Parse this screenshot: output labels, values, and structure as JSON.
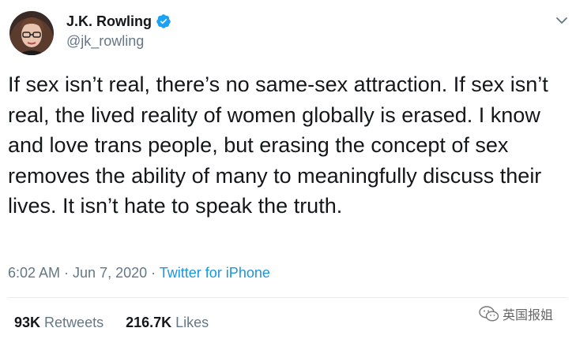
{
  "author": {
    "display_name": "J.K. Rowling",
    "handle": "@jk_rowling",
    "verified_icon": "verified-badge-icon",
    "avatar_icon": "avatar"
  },
  "tweet": {
    "text": "If sex isn’t real, there’s no same-sex attraction. If sex isn’t real, the lived reality of women globally is erased. I know and love trans people, but erasing the concept of sex removes the ability of many to meaningfully discuss their lives. It isn’t hate to speak the truth."
  },
  "meta": {
    "time": "6:02 AM",
    "separator": " · ",
    "date": "Jun 7, 2020",
    "source": "Twitter for iPhone"
  },
  "stats": {
    "retweets_count": "93K",
    "retweets_label": "Retweets",
    "likes_count": "216.7K",
    "likes_label": "Likes"
  },
  "watermark": {
    "text": "英国报姐"
  },
  "colors": {
    "accent": "#1b95e0",
    "secondary_text": "#657786",
    "verified": "#1da1f2"
  }
}
